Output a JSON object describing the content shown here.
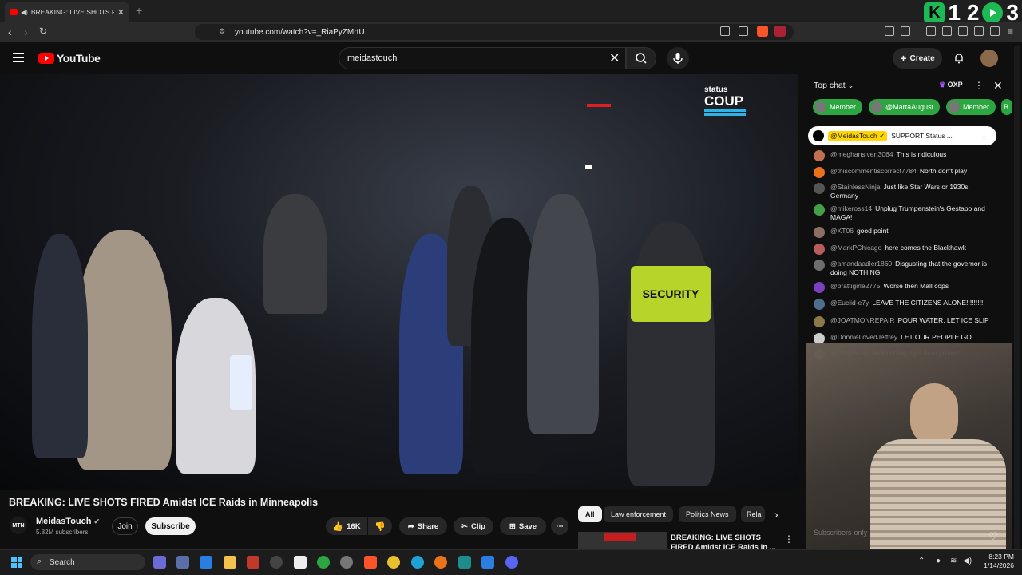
{
  "browser": {
    "tab_title": "BREAKING: LIVE SHOTS FIRED",
    "url": "youtube.com/watch?v=_RiaPyZMrtU"
  },
  "overlay": {
    "num1": "1 2",
    "num2": "3"
  },
  "youtube": {
    "logo_text": "YouTube",
    "search_value": "meidastouch",
    "create_label": "Create"
  },
  "video": {
    "watermark_line1": "status",
    "watermark_line2": "COUP",
    "security_text": "SECURITY",
    "title": "BREAKING: LIVE SHOTS FIRED Amidst ICE Raids in Minneapolis"
  },
  "channel": {
    "avatar_text": "MTN",
    "name": "MeidasTouch",
    "subscribers": "5.82M subscribers",
    "join_label": "Join",
    "subscribe_label": "Subscribe"
  },
  "actions": {
    "likes": "16K",
    "share": "Share",
    "clip": "Clip",
    "save": "Save"
  },
  "chips": [
    "All",
    "Law enforcement",
    "Politics News",
    "Rela"
  ],
  "recommended": {
    "title": "BREAKING: LIVE SHOTS FIRED Amidst ICE Raids in ..."
  },
  "chat": {
    "header": "Top chat",
    "oxp": "OXP",
    "members": [
      "Member",
      "@MartaAugust",
      "Member",
      "B"
    ],
    "pinned_author": "@MeidasTouch ✓",
    "pinned_text": "SUPPORT Status ...",
    "messages": [
      {
        "author": "@meghansivert3064",
        "text": "This is ridiculous",
        "color": "#c0704f"
      },
      {
        "author": "@thiscommentiscorrect7784",
        "text": "North don't play",
        "color": "#e8711a"
      },
      {
        "author": "@StainlessNinja",
        "text": "Just like Star Wars or 1930s Germany",
        "color": "#555555"
      },
      {
        "author": "@mikeross14",
        "text": "Unplug Trumpenstein's Gestapo and MAGA!",
        "color": "#43a047"
      },
      {
        "author": "@KT06",
        "text": "good point",
        "color": "#8d6e63"
      },
      {
        "author": "@MarkPChicago",
        "text": "here comes the Blackhawk",
        "color": "#b85c5c"
      },
      {
        "author": "@amandaadler1860",
        "text": "Disgusting that the governor is doing NOTHING",
        "color": "#6d6d6d"
      },
      {
        "author": "@brattigirle2775",
        "text": "Worse then Mall cops",
        "color": "#7b3fc0"
      },
      {
        "author": "@Euclid-e7y",
        "text": "LEAVE THE CITIZENS ALONE!!!!!!!!!!",
        "color": "#4e6e8e"
      },
      {
        "author": "@JOATMONREPAIR",
        "text": "POUR WATER, LET ICE SLIP",
        "color": "#8a7a4a"
      },
      {
        "author": "@DonnieLovedJeffrey",
        "text": "LET OUR PEOPLE GO",
        "color": "#cccccc"
      },
      {
        "author": "@PilatesLaw",
        "text": "even doing right here protect",
        "color": "#9a7a6a"
      }
    ],
    "input_placeholder": "Subscribers-only"
  },
  "taskbar": {
    "search": "Search",
    "time": "8:23 PM",
    "date": "1/14/2026"
  }
}
